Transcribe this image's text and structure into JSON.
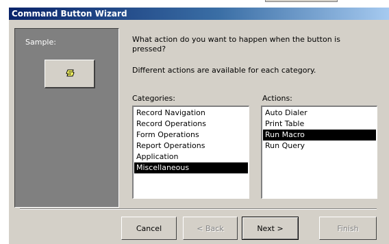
{
  "window": {
    "title": "Command Button Wizard"
  },
  "sample": {
    "label": "Sample:"
  },
  "prompt": {
    "question": "What action do you want to happen when the button is pressed?",
    "hint": "Different actions are available for each category."
  },
  "categories": {
    "label": "Categories:",
    "items": [
      "Record Navigation",
      "Record Operations",
      "Form Operations",
      "Report Operations",
      "Application",
      "Miscellaneous"
    ],
    "selected": "Miscellaneous"
  },
  "actions": {
    "label": "Actions:",
    "items": [
      "Auto Dialer",
      "Print Table",
      "Run Macro",
      "Run Query"
    ],
    "selected": "Run Macro"
  },
  "buttons": {
    "cancel": "Cancel",
    "back": "< Back",
    "next": "Next >",
    "finish": "Finish"
  },
  "icons": {
    "sample": "scroll-icon"
  },
  "colors": {
    "title_start": "#0a246a",
    "title_end": "#a6caf0",
    "face": "#d4d0c8",
    "selection": "#000000"
  }
}
